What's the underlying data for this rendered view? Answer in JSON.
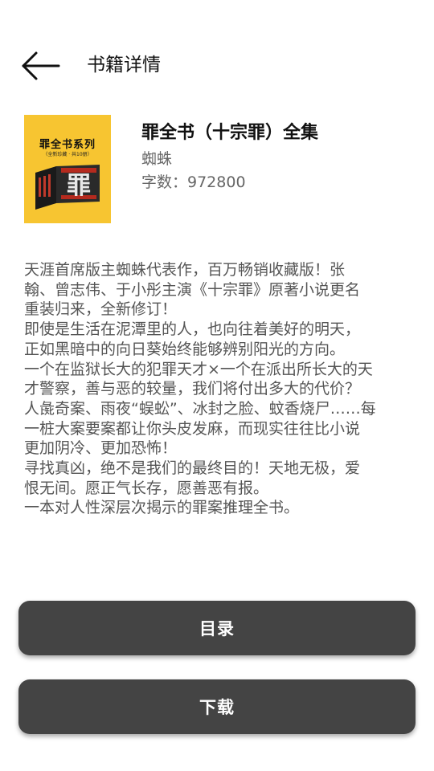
{
  "header": {
    "title": "书籍详情",
    "back_icon": "arrow-left-icon"
  },
  "book": {
    "cover": {
      "series_title": "罪全书系列",
      "series_subtitle": "（全新珍藏 · 共10册）",
      "big_char": "罪",
      "background_color": "#f7c531"
    },
    "title": "罪全书（十宗罪）全集",
    "author": "蜘蛛",
    "word_count": "字数：972800"
  },
  "description": {
    "lines": [
      "天涯首席版主蜘蛛代表作，百万畅销收藏版！张",
      "翰、曾志伟、于小彤主演《十宗罪》原著小说更名",
      "重装归来，全新修订！",
      "即使是生活在泥潭里的人，也向往着美好的明天，",
      "正如黑暗中的向日葵始终能够辨别阳光的方向。",
      "一个在监狱长大的犯罪天才×一个在派出所长大的天",
      "才警察，善与恶的较量，我们将付出多大的代价？",
      "人彘奇案、雨夜“蜈蚣”、冰封之脸、蚊香烧尸……每",
      "一桩大案要案都让你头皮发麻，而现实往往比小说",
      "更加阴冷、更加恐怖！",
      "寻找真凶，绝不是我们的最终目的！天地无极，爱",
      "恨无间。愿正气长存，愿善恶有报。",
      "一本对人性深层次揭示的罪案推理全书。"
    ]
  },
  "actions": {
    "toc_label": "目录",
    "download_label": "下载",
    "button_color": "#444444"
  }
}
